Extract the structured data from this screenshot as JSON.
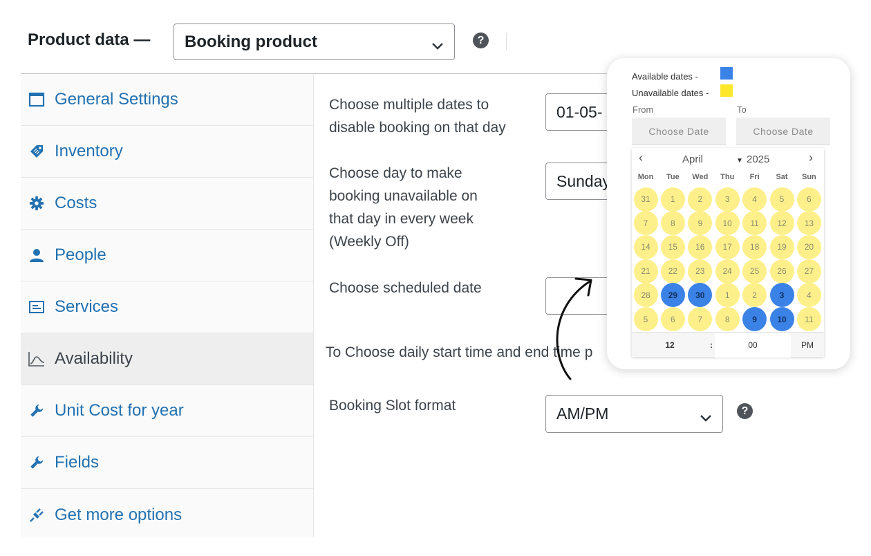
{
  "header": {
    "title": "Product data —",
    "product_type": "Booking product"
  },
  "sidebar": {
    "items": [
      {
        "label": "General Settings",
        "icon": "window-icon"
      },
      {
        "label": "Inventory",
        "icon": "tag-icon"
      },
      {
        "label": "Costs",
        "icon": "gear-icon"
      },
      {
        "label": "People",
        "icon": "person-icon"
      },
      {
        "label": "Services",
        "icon": "card-icon"
      },
      {
        "label": "Availability",
        "icon": "chart-curve-icon",
        "active": true
      },
      {
        "label": "Unit Cost for year",
        "icon": "wrench-icon"
      },
      {
        "label": "Fields",
        "icon": "wrench-icon"
      },
      {
        "label": "Get more options",
        "icon": "plug-icon"
      }
    ]
  },
  "form": {
    "disable_dates_label_1": "Choose multiple dates to",
    "disable_dates_label_2": "disable booking on that day",
    "disable_dates_value": "01-05-",
    "weekly_off_label_1": "Choose day to make",
    "weekly_off_label_2": "booking unavailable on",
    "weekly_off_label_3": "that day in every week",
    "weekly_off_label_4": "(Weekly Off)",
    "weekly_off_value": "Sunday",
    "scheduled_date_label": "Choose scheduled date",
    "scheduled_date_value": "",
    "daily_time_note": "To Choose daily start time and end time p",
    "slot_format_label": "Booking Slot format",
    "slot_format_value": "AM/PM"
  },
  "popup": {
    "available_label": "Available dates -",
    "unavailable_label": "Unavailable dates -",
    "available_color": "#3b82e6",
    "unavailable_color": "#fde72a",
    "from_label": "From",
    "to_label": "To",
    "from_placeholder": "Choose Date",
    "to_placeholder": "Choose Date",
    "calendar": {
      "prev": "‹",
      "next": "›",
      "month": "April",
      "year": "2025",
      "weekdays": [
        "Mon",
        "Tue",
        "Wed",
        "Thu",
        "Fri",
        "Sat",
        "Sun"
      ],
      "days": [
        "31",
        "1",
        "2",
        "3",
        "4",
        "5",
        "6",
        "7",
        "8",
        "9",
        "10",
        "11",
        "12",
        "13",
        "14",
        "15",
        "16",
        "17",
        "18",
        "19",
        "20",
        "21",
        "22",
        "23",
        "24",
        "25",
        "26",
        "27",
        "28",
        "29",
        "30",
        "1",
        "2",
        "3",
        "4",
        "5",
        "6",
        "7",
        "8",
        "9",
        "10",
        "11"
      ],
      "available_cells": [
        29,
        30,
        33,
        39,
        40
      ],
      "hour": "12",
      "separator": ":",
      "minute": "00",
      "ampm": "PM"
    }
  }
}
